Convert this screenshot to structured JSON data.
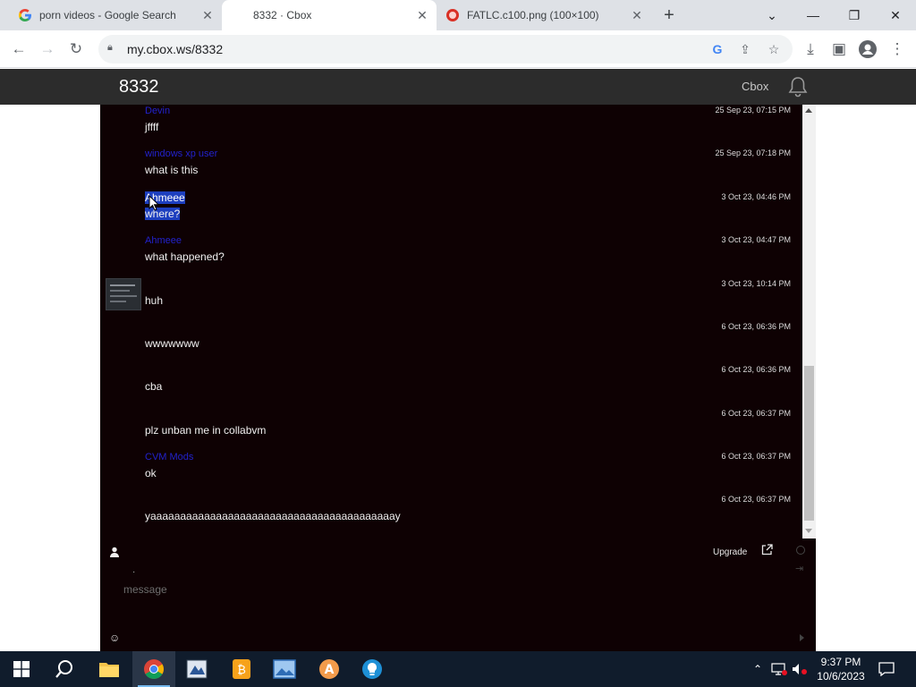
{
  "browser": {
    "tabs": [
      {
        "title": "porn videos - Google Search",
        "active": false
      },
      {
        "title": "8332 · Cbox",
        "active": true
      },
      {
        "title": "FATLC.c100.png (100×100)",
        "active": false
      }
    ],
    "url": "my.cbox.ws/8332"
  },
  "cbox": {
    "title": "8332",
    "brand": "Cbox",
    "upgrade_label": "Upgrade",
    "input_placeholder": "message",
    "input_dot": "·",
    "accent_colors": {
      "header": "#2c2c2c",
      "background": "#0e0103",
      "username": "#2222cc",
      "selection": "#1d3fbf"
    },
    "messages": [
      {
        "name": "Devin",
        "time": "25 Sep 23, 07:15 PM",
        "text": "jffff"
      },
      {
        "name": "windows xp user",
        "time": "25 Sep 23, 07:18 PM",
        "text": "what is this"
      },
      {
        "name": "Ahmeee",
        "time": "3 Oct 23, 04:46 PM",
        "text": "where?",
        "selected": true
      },
      {
        "name": "Ahmeee",
        "time": "3 Oct 23, 04:47 PM",
        "text": "what happened?"
      },
      {
        "name": "",
        "time": "3 Oct 23, 10:14 PM",
        "text": "huh",
        "avatar": true
      },
      {
        "name": "",
        "time": "6 Oct 23, 06:36 PM",
        "text": "wwwwwww"
      },
      {
        "name": "",
        "time": "6 Oct 23, 06:36 PM",
        "text": "cba"
      },
      {
        "name": "",
        "time": "6 Oct 23, 06:37 PM",
        "text": "plz unban me in collabvm"
      },
      {
        "name": "CVM Mods",
        "time": "6 Oct 23, 06:37 PM",
        "text": "ok"
      },
      {
        "name": "",
        "time": "6 Oct 23, 06:37 PM",
        "text": "yaaaaaaaaaaaaaaaaaaaaaaaaaaaaaaaaaaaaaaaaay"
      }
    ]
  },
  "taskbar": {
    "time": "9:37 PM",
    "date": "10/6/2023",
    "apps": [
      "start-icon",
      "search-icon",
      "file-explorer-icon",
      "chrome-icon",
      "app-icon",
      "bitcoin-app-icon",
      "image-app-icon",
      "letter-a-app-icon",
      "lightbulb-app-icon"
    ]
  }
}
